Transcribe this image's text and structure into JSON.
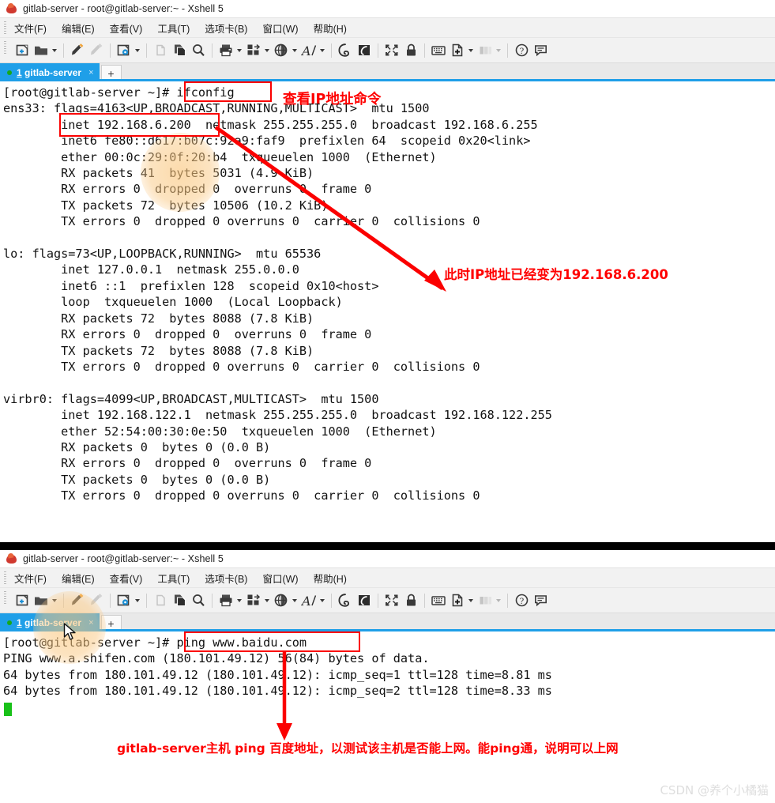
{
  "windows": [
    {
      "title": "gitlab-server - root@gitlab-server:~ - Xshell 5",
      "menu": [
        "文件(F)",
        "编辑(E)",
        "查看(V)",
        "工具(T)",
        "选项卡(B)",
        "窗口(W)",
        "帮助(H)"
      ],
      "tab": {
        "index": "1",
        "name": "gitlab-server",
        "close": "×",
        "new": "+"
      },
      "terminal": "[root@gitlab-server ~]# ifconfig\nens33: flags=4163<UP,BROADCAST,RUNNING,MULTICAST>  mtu 1500\n        inet 192.168.6.200  netmask 255.255.255.0  broadcast 192.168.6.255\n        inet6 fe80::d617:b07c:92a9:faf9  prefixlen 64  scopeid 0x20<link>\n        ether 00:0c:29:0f:20:b4  txqueuelen 1000  (Ethernet)\n        RX packets 41  bytes 5031 (4.9 KiB)\n        RX errors 0  dropped 0  overruns 0  frame 0\n        TX packets 72  bytes 10506 (10.2 KiB)\n        TX errors 0  dropped 0 overruns 0  carrier 0  collisions 0\n\nlo: flags=73<UP,LOOPBACK,RUNNING>  mtu 65536\n        inet 127.0.0.1  netmask 255.0.0.0\n        inet6 ::1  prefixlen 128  scopeid 0x10<host>\n        loop  txqueuelen 1000  (Local Loopback)\n        RX packets 72  bytes 8088 (7.8 KiB)\n        RX errors 0  dropped 0  overruns 0  frame 0\n        TX packets 72  bytes 8088 (7.8 KiB)\n        TX errors 0  dropped 0 overruns 0  carrier 0  collisions 0\n\nvirbr0: flags=4099<UP,BROADCAST,MULTICAST>  mtu 1500\n        inet 192.168.122.1  netmask 255.255.255.0  broadcast 192.168.122.255\n        ether 52:54:00:30:0e:50  txqueuelen 1000  (Ethernet)\n        RX packets 0  bytes 0 (0.0 B)\n        RX errors 0  dropped 0  overruns 0  frame 0\n        TX packets 0  bytes 0 (0.0 B)\n        TX errors 0  dropped 0 overruns 0  carrier 0  collisions 0"
    },
    {
      "title": "gitlab-server - root@gitlab-server:~ - Xshell 5",
      "menu": [
        "文件(F)",
        "编辑(E)",
        "查看(V)",
        "工具(T)",
        "选项卡(B)",
        "窗口(W)",
        "帮助(H)"
      ],
      "tab": {
        "index": "1",
        "name": "gitlab-server",
        "close": "×",
        "new": "+"
      },
      "terminal": "[root@gitlab-server ~]# ping www.baidu.com\nPING www.a.shifen.com (180.101.49.12) 56(84) bytes of data.\n64 bytes from 180.101.49.12 (180.101.49.12): icmp_seq=1 ttl=128 time=8.81 ms\n64 bytes from 180.101.49.12 (180.101.49.12): icmp_seq=2 ttl=128 time=8.33 ms"
    }
  ],
  "annotations": {
    "top_command_note": "查看IP地址命令",
    "ip_changed_note": "此时IP地址已经变为192.168.6.200",
    "ping_note": "gitlab-server主机 ping 百度地址，以测试该主机是否能上网。能ping通，说明可以上网",
    "highlight_color": "#fb0000"
  },
  "watermark": "CSDN @养个小橘猫"
}
